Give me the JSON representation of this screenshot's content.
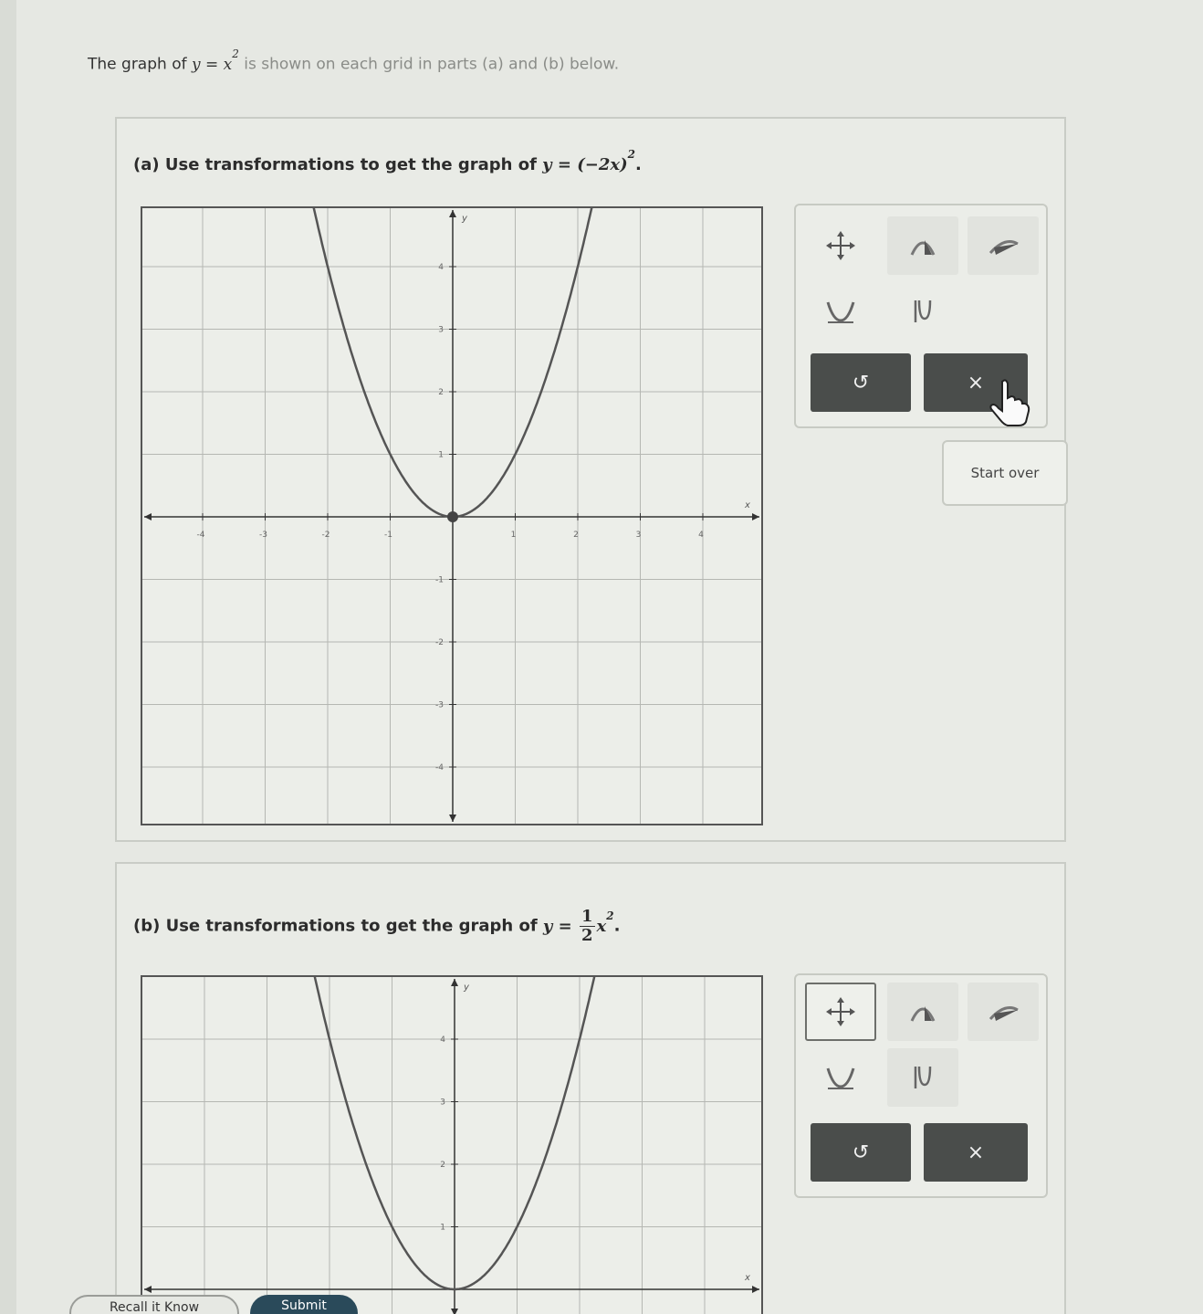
{
  "intro": {
    "prefix": "The graph of ",
    "equation_base": "y = x",
    "equation_exp": "2",
    "suffix": " is shown on each grid in parts (a) and (b) below."
  },
  "part_a": {
    "label": "(a) Use transformations to get the graph of ",
    "equation_base": "y = (−2x)",
    "equation_exp": "2",
    "period": ".",
    "x_axis_label": "x",
    "y_axis_label": "y",
    "x_ticks": [
      "-4",
      "-3",
      "-2",
      "-1",
      "1",
      "2",
      "3",
      "4"
    ],
    "y_ticks": [
      "4",
      "3",
      "2",
      "1",
      "-1",
      "-2",
      "-3",
      "-4"
    ],
    "curve": {
      "label": "y = x²",
      "vertex": [
        0,
        0
      ]
    }
  },
  "part_b": {
    "label": "(b) Use transformations to get the graph of ",
    "equation_lhs": "y =",
    "frac_num": "1",
    "frac_den": "2",
    "equation_var": "x",
    "equation_exp": "2",
    "period": ".",
    "y_axis_label": "y",
    "x_axis_label": "x",
    "y_ticks": [
      "4",
      "3",
      "2",
      "1"
    ]
  },
  "tools": {
    "move": "move-arrows-icon",
    "reflect_y": "reflect-vertical-icon",
    "reflect_x": "reflect-horizontal-icon",
    "stretch": "vertical-stretch-icon",
    "shrink": "vertical-shrink-icon",
    "undo_label": "↺",
    "clear_label": "×",
    "start_over_label": "Start over"
  },
  "bottom": {
    "help_label": "Recall it Know",
    "submit_label": "Submit"
  },
  "colors": {
    "curve": "#555555",
    "axis": "#333333",
    "grid": "#b5b7b2",
    "button_dark": "#4a4d4b"
  }
}
